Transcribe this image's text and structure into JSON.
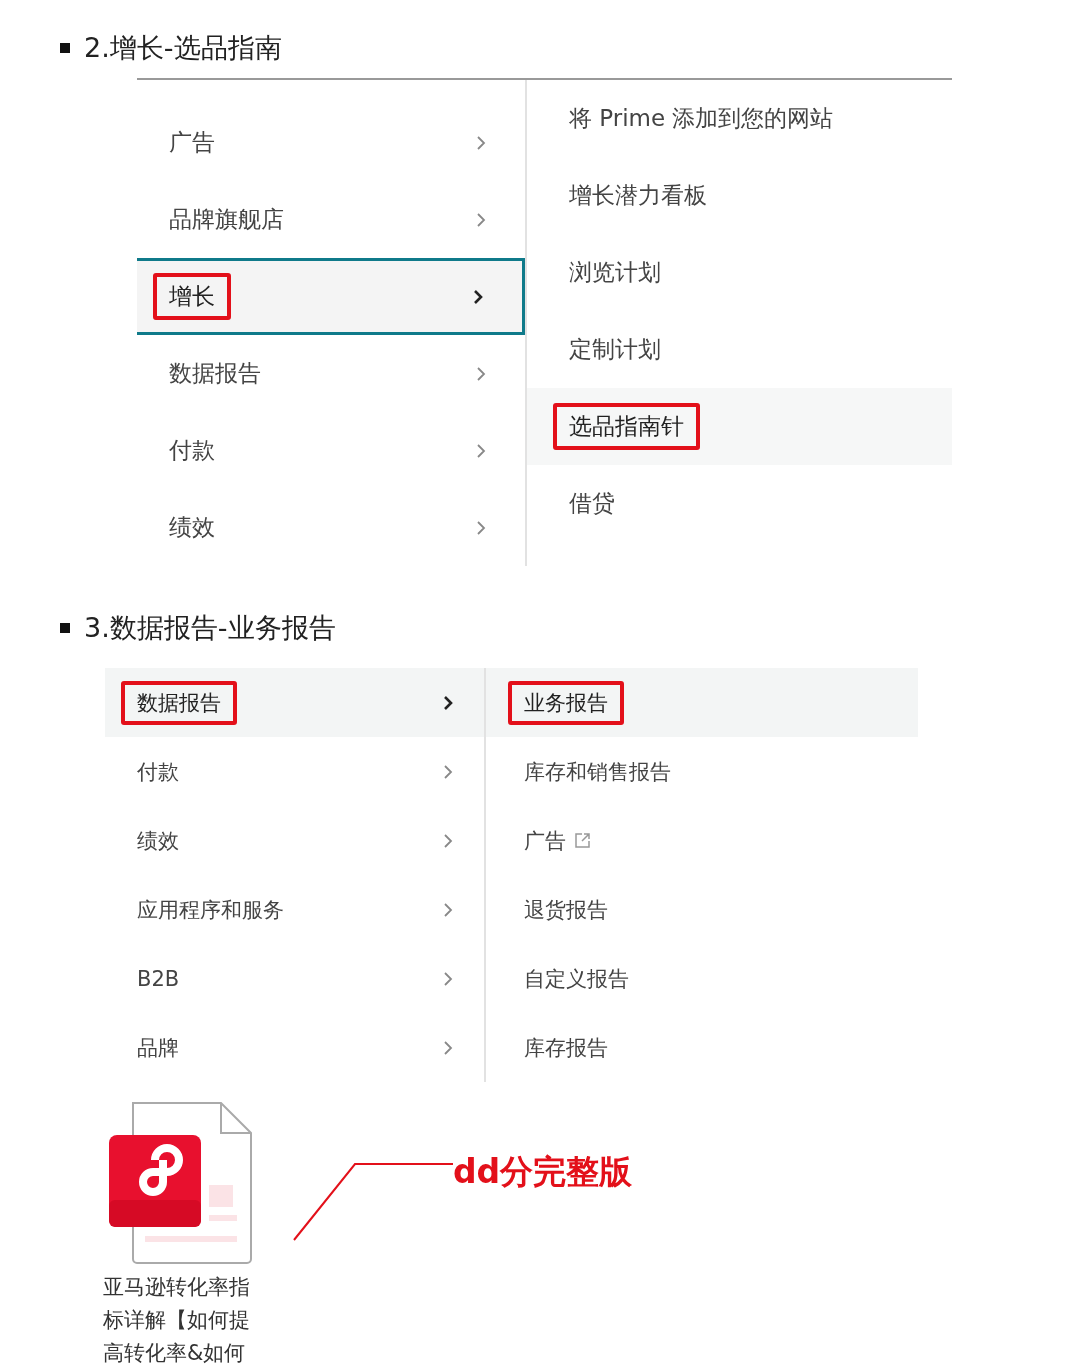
{
  "sections": [
    {
      "heading": "2.增长-选品指南",
      "kind": "bordered",
      "left_menu": [
        {
          "label": "广告",
          "selected": false,
          "marked": false
        },
        {
          "label": "品牌旗舰店",
          "selected": false,
          "marked": false
        },
        {
          "label": "增长",
          "selected": true,
          "marked": true
        },
        {
          "label": "数据报告",
          "selected": false,
          "marked": false
        },
        {
          "label": "付款",
          "selected": false,
          "marked": false
        },
        {
          "label": "绩效",
          "selected": false,
          "marked": false
        }
      ],
      "right_menu": [
        {
          "label": "将 Prime 添加到您的网站",
          "selected": false,
          "marked": false,
          "external": false
        },
        {
          "label": "增长潜力看板",
          "selected": false,
          "marked": false,
          "external": false
        },
        {
          "label": "浏览计划",
          "selected": false,
          "marked": false,
          "external": false
        },
        {
          "label": "定制计划",
          "selected": false,
          "marked": false,
          "external": false
        },
        {
          "label": "选品指南针",
          "selected": true,
          "marked": true,
          "external": false
        },
        {
          "label": "借贷",
          "selected": false,
          "marked": false,
          "external": false
        }
      ]
    },
    {
      "heading": "3.数据报告-业务报告",
      "kind": "shaded",
      "left_menu": [
        {
          "label": "数据报告",
          "selected": true,
          "marked": true
        },
        {
          "label": "付款",
          "selected": false,
          "marked": false
        },
        {
          "label": "绩效",
          "selected": false,
          "marked": false
        },
        {
          "label": "应用程序和服务",
          "selected": false,
          "marked": false
        },
        {
          "label": "B2B",
          "selected": false,
          "marked": false
        },
        {
          "label": "品牌",
          "selected": false,
          "marked": false
        }
      ],
      "right_menu": [
        {
          "label": "业务报告",
          "selected": true,
          "marked": true,
          "external": false
        },
        {
          "label": "库存和销售报告",
          "selected": false,
          "marked": false,
          "external": false
        },
        {
          "label": "广告",
          "selected": false,
          "marked": false,
          "external": true
        },
        {
          "label": "退货报告",
          "selected": false,
          "marked": false,
          "external": false
        },
        {
          "label": "自定义报告",
          "selected": false,
          "marked": false,
          "external": false
        },
        {
          "label": "库存报告",
          "selected": false,
          "marked": false,
          "external": false
        }
      ]
    }
  ],
  "attachment": {
    "caption": "亚马逊转化率指标详解【如何提高转化率&如何",
    "annotation": "dd分完整版"
  }
}
